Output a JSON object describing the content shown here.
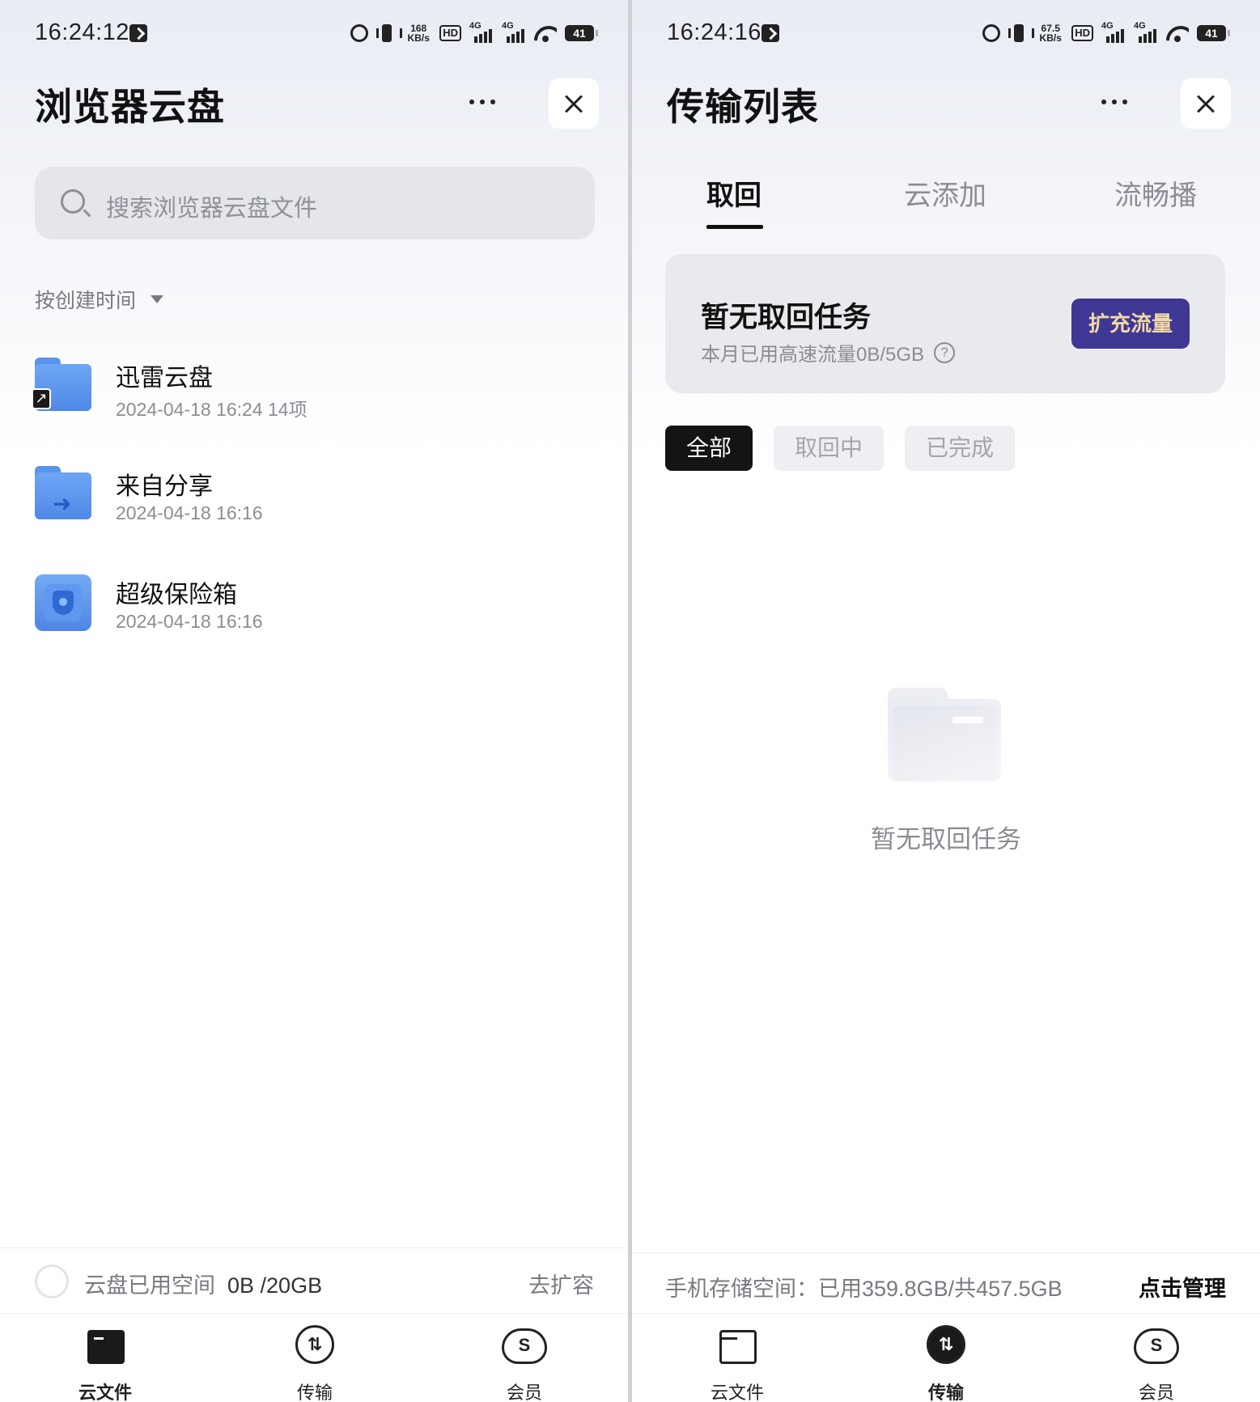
{
  "left": {
    "status": {
      "time": "16:24:12",
      "speed": "168",
      "speed_unit": "KB/s",
      "hd": "HD",
      "sig1": "4G",
      "sig2": "4G",
      "battery": "41"
    },
    "title": "浏览器云盘",
    "search": {
      "placeholder": "搜索浏览器云盘文件"
    },
    "sort_label": "按创建时间",
    "files": [
      {
        "name": "迅雷云盘",
        "meta": "2024-04-18 16:24 14项",
        "icon": "folder-shortcut-icon"
      },
      {
        "name": "来自分享",
        "meta": "2024-04-18 16:16",
        "icon": "shared-folder-icon"
      },
      {
        "name": "超级保险箱",
        "meta": "2024-04-18 16:16",
        "icon": "safe-box-icon"
      }
    ],
    "storage": {
      "label": "云盘已用空间",
      "value": "0B /20GB",
      "expand": "去扩容"
    },
    "nav": [
      {
        "label": "云文件",
        "active": true
      },
      {
        "label": "传输",
        "active": false
      },
      {
        "label": "会员",
        "active": false
      }
    ]
  },
  "right": {
    "status": {
      "time": "16:24:16",
      "speed": "67.5",
      "speed_unit": "KB/s",
      "hd": "HD",
      "sig1": "4G",
      "sig2": "4G",
      "battery": "41"
    },
    "title": "传输列表",
    "tabs": [
      {
        "label": "取回",
        "active": true
      },
      {
        "label": "云添加",
        "active": false
      },
      {
        "label": "流畅播",
        "active": false
      }
    ],
    "quota": {
      "title": "暂无取回任务",
      "sub": "本月已用高速流量0B/5GB",
      "button": "扩充流量"
    },
    "chips": [
      {
        "label": "全部",
        "active": true
      },
      {
        "label": "取回中",
        "active": false
      },
      {
        "label": "已完成",
        "active": false
      }
    ],
    "empty_text": "暂无取回任务",
    "phone_storage": {
      "text": "手机存储空间：已用359.8GB/共457.5GB",
      "manage": "点击管理"
    },
    "nav": [
      {
        "label": "云文件",
        "active": false
      },
      {
        "label": "传输",
        "active": true
      },
      {
        "label": "会员",
        "active": false
      }
    ]
  },
  "colors": {
    "accent_button": "#3f3794",
    "accent_button_text": "#f1d9a6",
    "folder_blue": "#5a93ec"
  }
}
